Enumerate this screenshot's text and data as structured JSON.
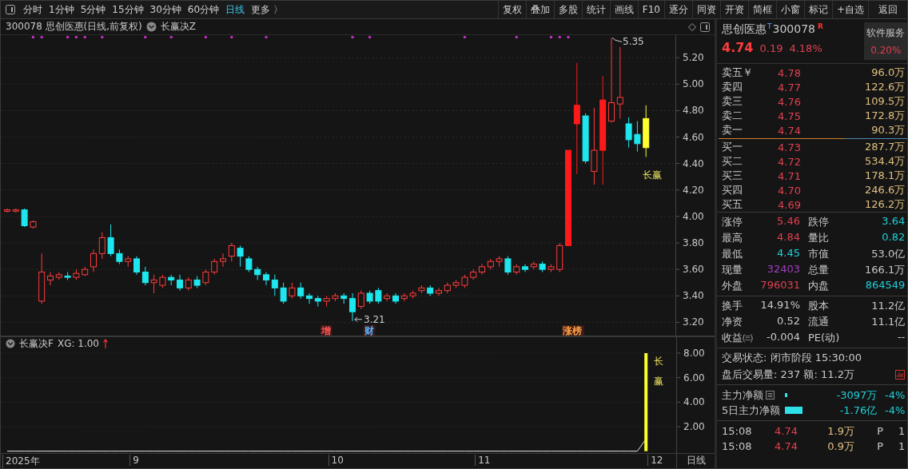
{
  "toolbar": {
    "tabs": [
      {
        "label": "分时",
        "selected": false
      },
      {
        "label": "1分钟",
        "selected": false
      },
      {
        "label": "5分钟",
        "selected": false
      },
      {
        "label": "15分钟",
        "selected": false
      },
      {
        "label": "30分钟",
        "selected": false
      },
      {
        "label": "60分钟",
        "selected": false
      },
      {
        "label": "日线",
        "selected": true
      },
      {
        "label": "更多 〉",
        "selected": false
      }
    ],
    "buttons": [
      "复权",
      "叠加",
      "多股",
      "统计",
      "画线",
      "F10",
      "逐分",
      "同资",
      "开资",
      "简框",
      "小窗",
      "标记",
      "+自选",
      "返回"
    ]
  },
  "main_chart": {
    "title": "300078 思创医惠(日线,前复权)",
    "indicator": "长赢决Z",
    "yticks": [
      "5.20",
      "5.00",
      "4.80",
      "4.60",
      "4.40",
      "4.20",
      "4.00",
      "3.80",
      "3.60",
      "3.40",
      "3.20"
    ],
    "candles": [
      {
        "kind": "up",
        "dot": false,
        "xlabel": "2025年"
      },
      {
        "kind": "up",
        "dot": false
      },
      {
        "kind": "down",
        "dot": false
      },
      {
        "kind": "up",
        "dot": true
      },
      {
        "kind": "up",
        "dot": true
      },
      {
        "kind": "up",
        "dot": false
      },
      {
        "kind": "up",
        "dot": false
      },
      {
        "kind": "down",
        "dot": true
      },
      {
        "kind": "up",
        "dot": true
      },
      {
        "kind": "up",
        "dot": true
      },
      {
        "kind": "up",
        "dot": false
      },
      {
        "kind": "up",
        "dot": true
      },
      {
        "kind": "down",
        "dot": false
      },
      {
        "kind": "down",
        "dot": false
      },
      {
        "kind": "up",
        "dot": false,
        "xlabel": "9"
      },
      {
        "kind": "down",
        "dot": false
      },
      {
        "kind": "down",
        "dot": true
      },
      {
        "kind": "up",
        "dot": false
      },
      {
        "kind": "up",
        "dot": false
      },
      {
        "kind": "down",
        "dot": true
      },
      {
        "kind": "down",
        "dot": false
      },
      {
        "kind": "up",
        "dot": false
      },
      {
        "kind": "down",
        "dot": false
      },
      {
        "kind": "up",
        "dot": true
      },
      {
        "kind": "up",
        "dot": false
      },
      {
        "kind": "up",
        "dot": false
      },
      {
        "kind": "up",
        "dot": true
      },
      {
        "kind": "down",
        "dot": false
      },
      {
        "kind": "down",
        "dot": false
      },
      {
        "kind": "down",
        "dot": false
      },
      {
        "kind": "down",
        "dot": true
      },
      {
        "kind": "down",
        "dot": false
      },
      {
        "kind": "down",
        "dot": false
      },
      {
        "kind": "up",
        "dot": false
      },
      {
        "kind": "down",
        "dot": false
      },
      {
        "kind": "down",
        "dot": false
      },
      {
        "kind": "down",
        "dot": false
      },
      {
        "kind": "up",
        "dot": false,
        "event": "增",
        "color": "#ff5050",
        "xlabel": "10"
      },
      {
        "kind": "up",
        "dot": false
      },
      {
        "kind": "down",
        "dot": false
      },
      {
        "kind": "down",
        "dot": true,
        "note": "3.21"
      },
      {
        "kind": "up",
        "dot": false
      },
      {
        "kind": "down",
        "dot": true,
        "event": "财",
        "color": "#5ab4ff"
      },
      {
        "kind": "down",
        "dot": false
      },
      {
        "kind": "up",
        "dot": false
      },
      {
        "kind": "down",
        "dot": false
      },
      {
        "kind": "up",
        "dot": false
      },
      {
        "kind": "up",
        "dot": false
      },
      {
        "kind": "up",
        "dot": false
      },
      {
        "kind": "down",
        "dot": false
      },
      {
        "kind": "up",
        "dot": false
      },
      {
        "kind": "up",
        "dot": false
      },
      {
        "kind": "up",
        "dot": false
      },
      {
        "kind": "up",
        "dot": true
      },
      {
        "kind": "up",
        "dot": false,
        "xlabel": "11"
      },
      {
        "kind": "up",
        "dot": false
      },
      {
        "kind": "up",
        "dot": false
      },
      {
        "kind": "up",
        "dot": false
      },
      {
        "kind": "down",
        "dot": false
      },
      {
        "kind": "up",
        "dot": true
      },
      {
        "kind": "down",
        "dot": false
      },
      {
        "kind": "up",
        "dot": false
      },
      {
        "kind": "down",
        "dot": false
      },
      {
        "kind": "up",
        "dot": true
      },
      {
        "kind": "up",
        "dot": true
      },
      {
        "kind": "solid",
        "dot": true,
        "event": "涨榜",
        "color": "#ffa040"
      },
      {
        "kind": "solid",
        "dot": false
      },
      {
        "kind": "down",
        "dot": false
      },
      {
        "kind": "up",
        "dot": false
      },
      {
        "kind": "solid",
        "dot": false
      },
      {
        "kind": "up",
        "dot": false,
        "note": "5.35"
      },
      {
        "kind": "up",
        "dot": false
      },
      {
        "kind": "down",
        "dot": false
      },
      {
        "kind": "down",
        "dot": false
      },
      {
        "kind": "signal",
        "dot": false,
        "label": "长赢",
        "xlabel": "12"
      }
    ]
  },
  "sub_chart": {
    "name": "长赢决F",
    "reading": "XG: 1.00",
    "yticks": [
      "8.00",
      "6.00",
      "4.00",
      "2.00"
    ],
    "signal_text": "长赢"
  },
  "x_axis": {
    "period": "日线"
  },
  "quote": {
    "name": "思创医惠",
    "code": "300078",
    "tag_t": "T",
    "tag_r": "R",
    "price": "4.74",
    "change": "0.19",
    "change_pct": "4.18%",
    "service_button": "软件服务",
    "service_value": "0.20%",
    "asks": [
      {
        "label": "卖五￥",
        "price": "4.78",
        "volume": "96.0万"
      },
      {
        "label": "卖四",
        "price": "4.77",
        "volume": "122.6万"
      },
      {
        "label": "卖三",
        "price": "4.76",
        "volume": "109.5万"
      },
      {
        "label": "卖二",
        "price": "4.75",
        "volume": "172.8万"
      },
      {
        "label": "卖一",
        "price": "4.74",
        "volume": "90.3万"
      }
    ],
    "bids": [
      {
        "label": "买一",
        "price": "4.73",
        "volume": "287.7万"
      },
      {
        "label": "买二",
        "price": "4.72",
        "volume": "534.4万"
      },
      {
        "label": "买三",
        "price": "4.71",
        "volume": "178.1万"
      },
      {
        "label": "买四",
        "price": "4.70",
        "volume": "246.6万"
      },
      {
        "label": "买五",
        "price": "4.69",
        "volume": "126.2万"
      }
    ],
    "stats": [
      {
        "label": "涨停",
        "value": "5.46",
        "color": "#e04050"
      },
      {
        "label": "跌停",
        "value": "3.64",
        "color": "#20d0d8"
      },
      {
        "label": "最高",
        "value": "4.84",
        "color": "#e04050"
      },
      {
        "label": "量比",
        "value": "0.82",
        "color": "#20d0d8"
      },
      {
        "label": "最低",
        "value": "4.45",
        "color": "#20d0d8"
      },
      {
        "label": "市值",
        "value": "53.0亿",
        "color": "#c8c8c8"
      },
      {
        "label": "现量",
        "value": "32403",
        "color": "#a040c0"
      },
      {
        "label": "总量",
        "value": "166.1万",
        "color": "#c8c8c8"
      },
      {
        "label": "外盘",
        "value": "796031",
        "color": "#e04050"
      },
      {
        "label": "内盘",
        "value": "864549",
        "color": "#20d0d8"
      }
    ],
    "fundamentals": [
      {
        "label": "换手",
        "value": "14.91%"
      },
      {
        "label": "股本",
        "value": "11.2亿"
      },
      {
        "label": "净资",
        "value": "0.52"
      },
      {
        "label": "流通",
        "value": "11.1亿"
      },
      {
        "label": "收益㈢",
        "value": "-0.004"
      },
      {
        "label": "PE(动)",
        "value": "--"
      }
    ],
    "status": "交易状态: 闭市阶段 15:30:00",
    "after_hours": "盘后交易量: 237  额: 11.2万",
    "flows": [
      {
        "label": "主力净额",
        "has_icon": true,
        "amount": "-3097万",
        "pct": "-4%"
      },
      {
        "label": "5日主力净额",
        "has_icon": false,
        "amount": "-1.76亿",
        "pct": "-4%"
      }
    ],
    "trades": [
      {
        "time": "15:08",
        "price": "4.74",
        "volume": "1.9万",
        "flag": "P",
        "count": "1"
      },
      {
        "time": "15:08",
        "price": "4.74",
        "volume": "0.9万",
        "flag": "P",
        "count": "1"
      }
    ]
  }
}
